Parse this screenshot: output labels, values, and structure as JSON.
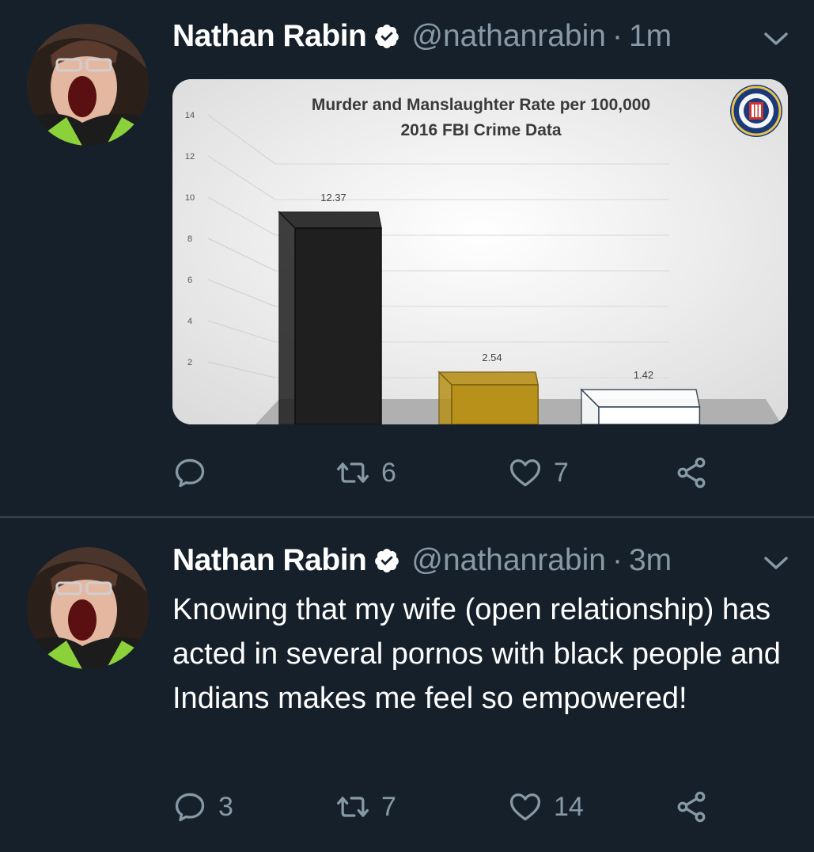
{
  "tweets": [
    {
      "name": "Nathan Rabin",
      "handle": "@nathanrabin",
      "separator": "·",
      "time": "1m",
      "text": "",
      "replies": "",
      "retweets": "6",
      "likes": "7"
    },
    {
      "name": "Nathan Rabin",
      "handle": "@nathanrabin",
      "separator": "·",
      "time": "3m",
      "text": "Knowing that my wife (open relationship) has acted in several pornos with black people and Indians makes me feel so empowered!",
      "replies": "3",
      "retweets": "7",
      "likes": "14"
    }
  ],
  "chart_data": {
    "type": "bar",
    "title": "Murder and Manslaughter Rate per 100,000",
    "subtitle": "2016 FBI Crime Data",
    "y_ticks": [
      "14",
      "12",
      "10",
      "8",
      "6",
      "4",
      "2"
    ],
    "ylim": [
      0,
      14
    ],
    "series": [
      {
        "values": [
          12.37,
          2.54,
          1.42
        ]
      }
    ],
    "value_labels": [
      "12.37",
      "2.54",
      "1.42"
    ],
    "bar_colors": [
      "#1f1f1f",
      "#b8911a",
      "#ffffff"
    ],
    "grid": true,
    "logo": "fbi-seal"
  },
  "colors": {
    "background": "#15202b",
    "secondary_text": "#8899a6",
    "divider": "#38444d",
    "verified": "#ffffff"
  }
}
